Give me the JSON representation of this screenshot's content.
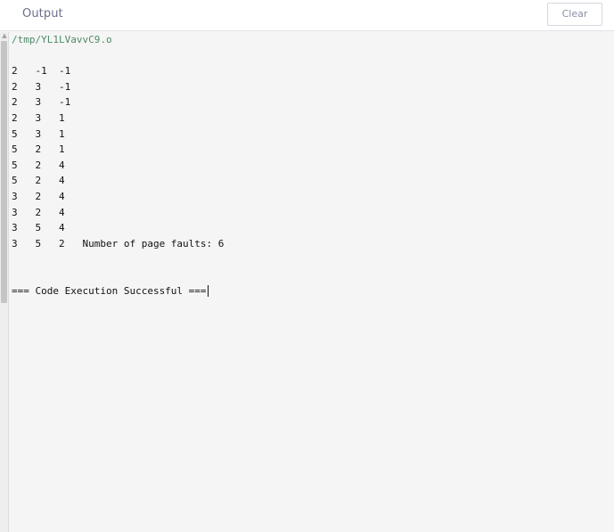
{
  "header": {
    "title": "Output",
    "clear_label": "Clear"
  },
  "output": {
    "path": "/tmp/YL1LVavvC9.o",
    "lines": [
      "",
      "2   -1  -1",
      "2   3   -1",
      "2   3   -1",
      "2   3   1",
      "5   3   1",
      "5   2   1",
      "5   2   4",
      "5   2   4",
      "3   2   4",
      "3   2   4",
      "3   5   4",
      "3   5   2   Number of page faults: 6",
      "",
      "",
      "=== Code Execution Successful ==="
    ]
  },
  "colors": {
    "path_text": "#4f8a6a",
    "header_title": "#6b6f8a",
    "background": "#f5f5f5"
  }
}
